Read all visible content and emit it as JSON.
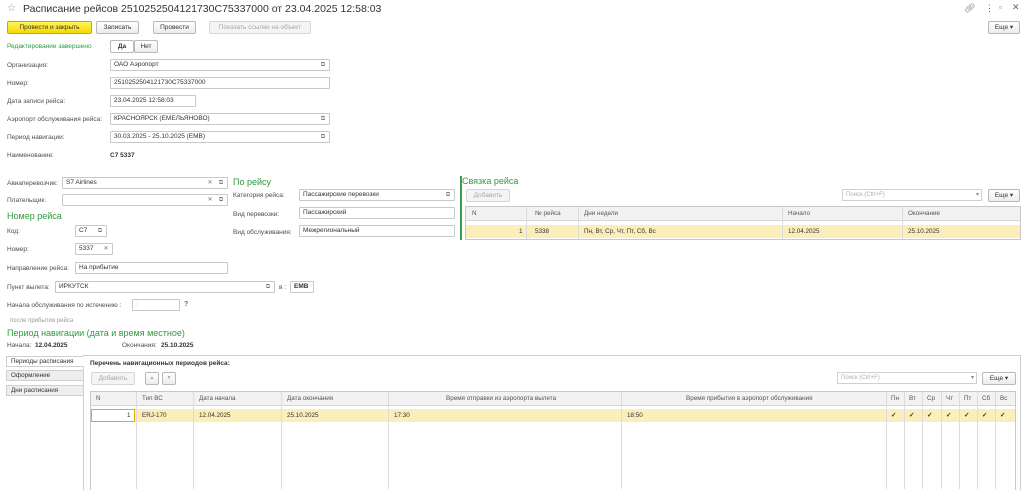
{
  "window": {
    "title": "Расписание рейсов 2510252504121730C75337000 от 23.04.2025 12:58:03",
    "more_label": "Еще ▾"
  },
  "toolbar": {
    "post_close": "Провести и закрыть",
    "save": "Записать",
    "post": "Провести",
    "show_links": "Показать ссылки на объект"
  },
  "edit_done": {
    "label": "Редактирование завершено",
    "yes": "Да",
    "no": "Нет"
  },
  "header": {
    "org_label": "Организация:",
    "org_value": "ОАО Аэропорт",
    "number_label": "Номер:",
    "number_value": "2510252504121730C75337000",
    "date_label": "Дата записи рейса:",
    "date_value": "23.04.2025 12:58:03",
    "airport_label": "Аэропорт обслуживания рейса:",
    "airport_value": "КРАСНОЯРСК (ЕМЕЛЬЯНОВО)",
    "period_label": "Период навигации:",
    "period_value": "30.03.2025 - 25.10.2025 (EMB)",
    "name_label": "Наименование:",
    "name_value": "C7 5337"
  },
  "carrier": {
    "airline_label": "Авиаперевозчик:",
    "airline_value": "S7 Airlines",
    "payer_label": "Плательщик:",
    "payer_value": "",
    "flight_no_title": "Номер рейса",
    "code_label": "Код:",
    "code_value": "C7",
    "num_label": "Номер:",
    "num_value": "5337",
    "direction_label": "Направление рейса:",
    "direction_value": "На прибытие",
    "departure_label": "Пункт вылета:",
    "departure_value": "ИРКУТСК",
    "in_label": "в :",
    "in_value": "EMB",
    "service_start_label": "Начала обслуживания по истечению :",
    "service_start_value": ":",
    "help": "?",
    "after_arrival": "после прибытия рейса"
  },
  "by_flight": {
    "title": "По рейсу",
    "category_label": "Категория рейса:",
    "category_value": "Пассажирские перевозки",
    "transport_label": "Вид перевозки:",
    "transport_value": "Пассажирский",
    "service_label": "Вид обслуживания:",
    "service_value": "Межрегиональный"
  },
  "link": {
    "title": "Связка рейса",
    "add": "Добавить",
    "search_placeholder": "Поиск (Ctrl+F)",
    "more": "Еще ▾",
    "columns": [
      "N",
      "№ рейса",
      "Дни недели",
      "Начало",
      "Окончание"
    ],
    "rows": [
      {
        "n": "1",
        "flight": "5338",
        "days": "Пн, Вт, Ср, Чт, Пт, Сб, Вс",
        "start": "12.04.2025",
        "end": "25.10.2025"
      }
    ]
  },
  "navigation": {
    "title": "Период навигации (дата и время местное)",
    "start_label": "Начала:",
    "start_value": "12.04.2025",
    "end_label": "Окончания:",
    "end_value": "25.10.2025"
  },
  "tabs": [
    "Периоды расписания",
    "Оформление",
    "Дни расписания"
  ],
  "periods": {
    "title": "Перечень навигационных периодов рейса:",
    "add": "Добавить",
    "up": "▲",
    "down": "▼",
    "search_placeholder": "Поиск (Ctrl+F)",
    "more": "Еще ▾",
    "columns": [
      "N",
      "Тип ВС",
      "Дата начала",
      "Дата окончания",
      "Время отправки из аэропорта вылета",
      "Время прибытия в аэропорт обслуживания",
      "Пн",
      "Вт",
      "Ср",
      "Чт",
      "Пт",
      "Сб",
      "Вс"
    ],
    "rows": [
      {
        "n": "1",
        "type": "ERJ-170",
        "start": "12.04.2025",
        "end": "25.10.2025",
        "dep": "17:30",
        "arr": "18:50",
        "days": [
          "✓",
          "✓",
          "✓",
          "✓",
          "✓",
          "✓",
          "✓"
        ]
      }
    ]
  }
}
